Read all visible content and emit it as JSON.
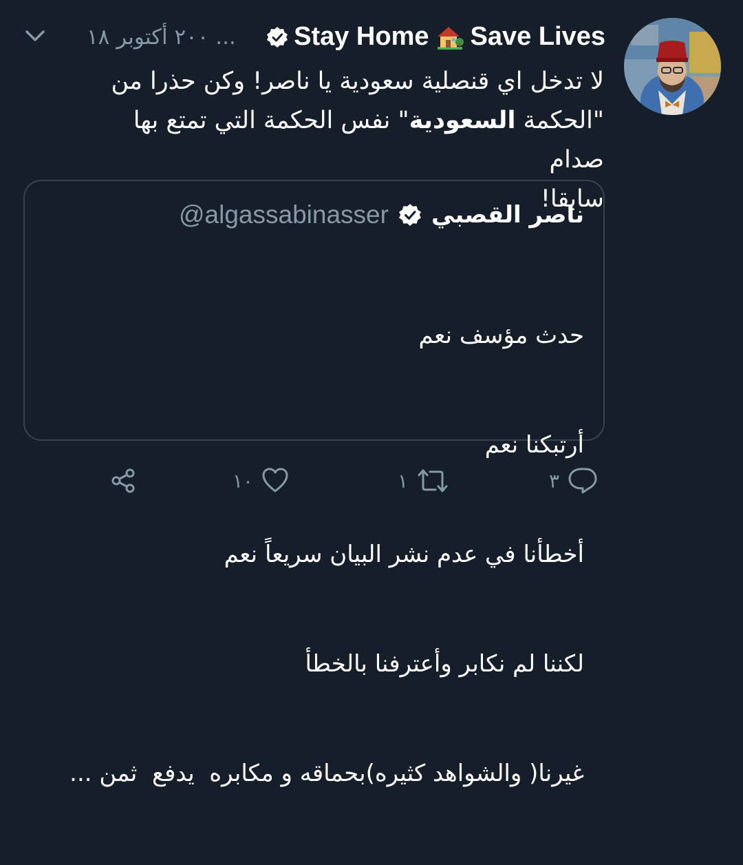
{
  "tweet": {
    "display_name": "Stay Home 🏡 Save Lives",
    "name_part1": "Stay Home",
    "name_part2": "Save Lives",
    "house_emoji": "house-with-garden-icon",
    "verified": true,
    "meta": "... ٢٠٠ أكتوبر ١٨",
    "text_line1": "لا تدخل اي قنصلية سعودية يا ناصر! وكن حذرا من",
    "text_line2_pre": "\"الحكمة ",
    "text_line2_bold": "السعودية",
    "text_line2_post": "\" نفس الحكمة التي تمتع بها صدام",
    "text_line3": "سابقا!"
  },
  "quoted": {
    "name": "ناصر القصبي",
    "handle": "@algassabinasser",
    "verified": true,
    "lines": [
      "حدث مؤسف نعم",
      "أرتبكنا نعم",
      "أخطأنا في عدم نشر البيان سريعاً نعم",
      "لكننا لم نكابر وأعترفنا بالخطأ",
      "غيرنا( والشواهد كثيره)بحماقه و مكابره  يدفع  ثمن ..."
    ]
  },
  "actions": {
    "reply_count": "٣",
    "retweet_count": "١",
    "like_count": "١٠"
  },
  "colors": {
    "background": "#151e29",
    "secondary_text": "#8899a6",
    "border": "#38444d"
  }
}
